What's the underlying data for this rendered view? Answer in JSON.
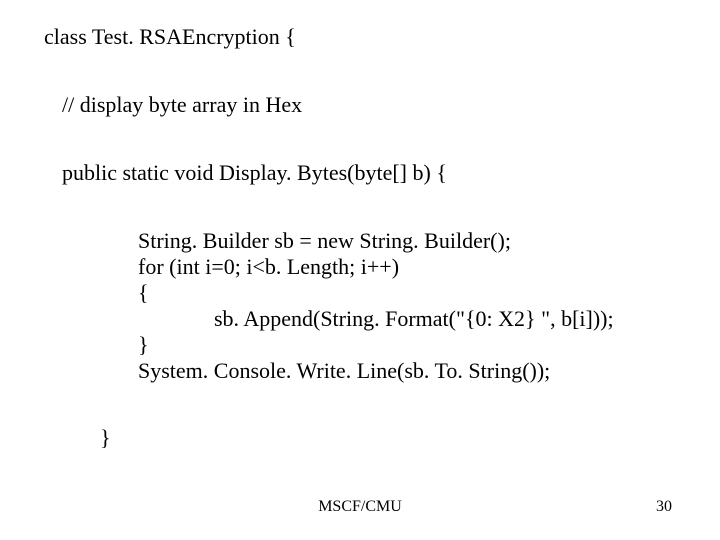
{
  "code": {
    "class_decl": "class Test. RSAEncryption {",
    "comment": "// display byte array in Hex",
    "method_sig": "public static void Display. Bytes(byte[] b) {",
    "sb_decl": "String. Builder sb = new String. Builder();",
    "for_line": "for (int i=0; i<b. Length; i++)",
    "open_brace": "{",
    "append_line": "sb. Append(String. Format(\"{0: X2} \", b[i]));",
    "close_brace": "}",
    "writeline": "System. Console. Write. Line(sb. To. String());",
    "method_close": "}"
  },
  "footer": {
    "center": "MSCF/CMU",
    "page": "30"
  }
}
